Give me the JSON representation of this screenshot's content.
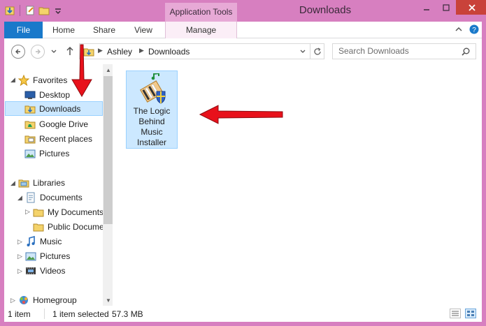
{
  "window": {
    "title": "Downloads",
    "contextual_tab_group": "Application Tools"
  },
  "ribbon": {
    "tabs": [
      {
        "label": "File"
      },
      {
        "label": "Home"
      },
      {
        "label": "Share"
      },
      {
        "label": "View"
      },
      {
        "label": "Manage"
      }
    ]
  },
  "address": {
    "breadcrumb": [
      {
        "label": "Ashley"
      },
      {
        "label": "Downloads"
      }
    ]
  },
  "search": {
    "placeholder": "Search Downloads"
  },
  "nav_pane": {
    "favorites": {
      "label": "Favorites",
      "items": [
        {
          "label": "Desktop",
          "icon": "desktop-icon"
        },
        {
          "label": "Downloads",
          "icon": "downloads-folder-icon",
          "selected": true
        },
        {
          "label": "Google Drive",
          "icon": "google-drive-icon"
        },
        {
          "label": "Recent places",
          "icon": "recent-places-icon"
        },
        {
          "label": "Pictures",
          "icon": "pictures-icon"
        }
      ]
    },
    "libraries": {
      "label": "Libraries",
      "documents": {
        "label": "Documents",
        "children": [
          {
            "label": "My Documents"
          },
          {
            "label": "Public Docume"
          }
        ]
      },
      "items": [
        {
          "label": "Music",
          "icon": "music-icon"
        },
        {
          "label": "Pictures",
          "icon": "pictures-icon"
        },
        {
          "label": "Videos",
          "icon": "videos-icon"
        }
      ]
    },
    "homegroup": {
      "label": "Homegroup"
    }
  },
  "content": {
    "files": [
      {
        "name": "The Logic Behind Music Installer",
        "icon": "installer-icon",
        "selected": true
      }
    ]
  },
  "status_bar": {
    "item_count": "1 item",
    "selection": "1 item selected",
    "size": "57.3 MB"
  },
  "colors": {
    "window_frame": "#d77fc0",
    "file_tab": "#1979ca",
    "selection": "#cce8ff",
    "annotation_arrow": "#e8111b"
  }
}
